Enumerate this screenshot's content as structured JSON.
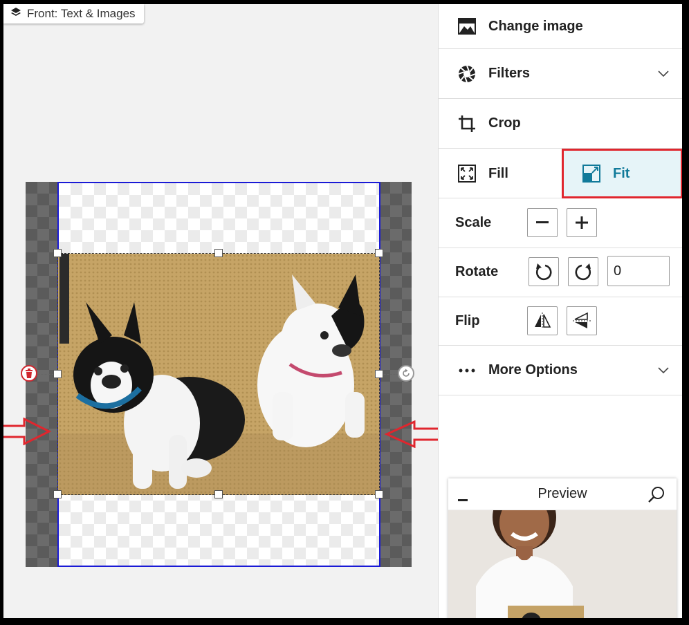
{
  "breadcrumb": {
    "label": "Front: Text & Images",
    "icon": "layers-icon"
  },
  "panel": {
    "change_image": "Change image",
    "filters": "Filters",
    "crop": "Crop",
    "fill": "Fill",
    "fit": "Fit",
    "scale": "Scale",
    "rotate": "Rotate",
    "rotate_value": "0",
    "flip": "Flip",
    "more_options": "More Options"
  },
  "preview": {
    "title": "Preview"
  },
  "colors": {
    "accent": "#117a9a",
    "highlight": "#e0262e",
    "print_border": "#1a1ad6",
    "fit_bg": "#e6f4f8"
  }
}
